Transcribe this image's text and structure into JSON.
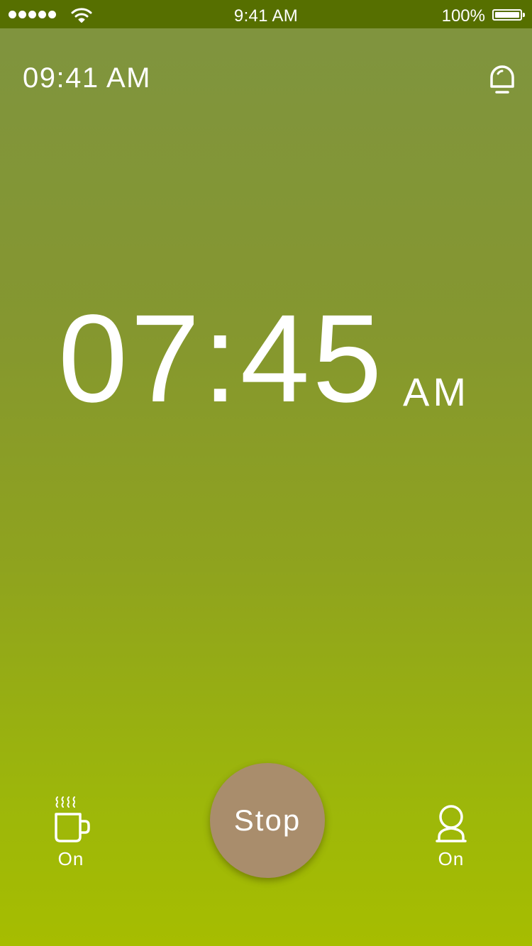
{
  "status_bar": {
    "time": "9:41 AM",
    "battery_percent": "100%",
    "battery_level": 1.0,
    "signal_bars": 5,
    "icons": [
      "signal-dots-icon",
      "wifi-icon",
      "battery-icon"
    ]
  },
  "header": {
    "current_time": "09:41 AM",
    "alarm_icon": "alarm-bell-icon"
  },
  "alarm": {
    "time": "07:45",
    "period": "AM"
  },
  "controls": {
    "coffee": {
      "icon": "coffee-cup-icon",
      "label": "On"
    },
    "stop": {
      "label": "Stop"
    },
    "person": {
      "icon": "person-icon",
      "label": "On"
    }
  },
  "colors": {
    "status_bar_bg": "#566f00",
    "gradient_top": "#7f9440",
    "gradient_bottom": "#a6bd00",
    "stop_button": "#a98d6c",
    "text": "#ffffff"
  }
}
